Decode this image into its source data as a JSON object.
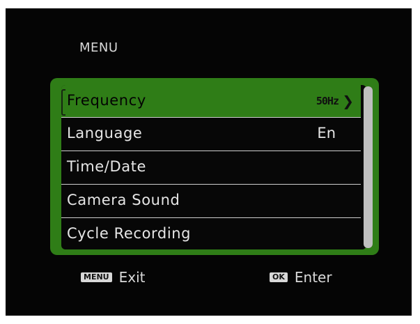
{
  "screen": {
    "title": "MENU"
  },
  "menu": {
    "items": [
      {
        "label": "Frequency",
        "value": "50Hz",
        "selected": true
      },
      {
        "label": "Language",
        "value": "En",
        "selected": false
      },
      {
        "label": "Time/Date",
        "value": "",
        "selected": false
      },
      {
        "label": "Camera Sound",
        "value": "",
        "selected": false
      },
      {
        "label": "Cycle Recording",
        "value": "",
        "selected": false
      }
    ]
  },
  "footer": {
    "exit_key": "MENU",
    "exit_label": "Exit",
    "enter_key": "OK",
    "enter_label": "Enter"
  },
  "colors": {
    "accent_green": "#2f7d17",
    "background": "#050505",
    "text": "#e6e6e6"
  }
}
